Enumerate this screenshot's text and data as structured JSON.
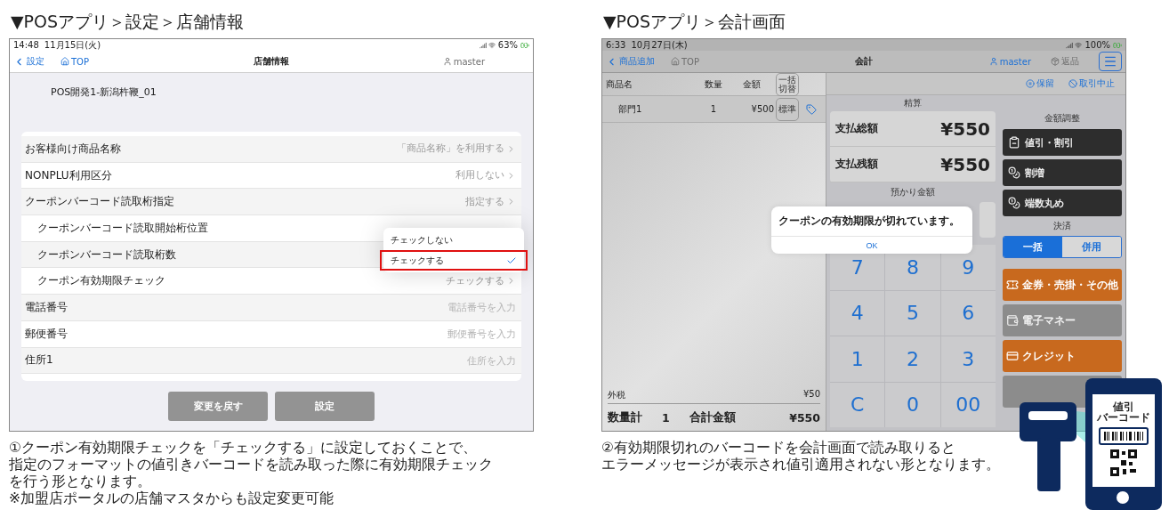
{
  "left_panel": {
    "heading": "▼POSアプリ＞設定＞店舗情報",
    "status_bar": {
      "time": "14:48",
      "date": "11月15日(火)",
      "battery": "63%"
    },
    "nav": {
      "back": "設定",
      "home": "TOP",
      "home_disabled": false,
      "title": "店舗情報",
      "user": "master",
      "user_disabled": true
    },
    "store_name": "POS開発1-新潟杵鞭_01",
    "rows": [
      {
        "kind": "select",
        "label": "お客様向け商品名称",
        "value": "「商品名称」を利用する",
        "indented": false
      },
      {
        "kind": "select",
        "label": "NONPLU利用区分",
        "value": "利用しない",
        "indented": false
      },
      {
        "kind": "select",
        "label": "クーポンバーコード読取桁指定",
        "value": "指定する",
        "indented": false
      },
      {
        "kind": "select",
        "label": "クーポンバーコード読取開始桁位置",
        "indented": true
      },
      {
        "kind": "select",
        "label": "クーポンバーコード読取桁数",
        "indented": true
      },
      {
        "kind": "select",
        "label": "クーポン有効期限チェック",
        "value": "チェックする",
        "indented": true
      },
      {
        "kind": "input",
        "label": "電話番号",
        "placeholder": "電話番号を入力",
        "indented": false
      },
      {
        "kind": "input",
        "label": "郵便番号",
        "placeholder": "郵便番号を入力",
        "indented": false
      },
      {
        "kind": "input",
        "label": "住所1",
        "placeholder": "住所を入力",
        "indented": false
      }
    ],
    "popup": {
      "options": [
        {
          "label": "チェックしない",
          "selected": false
        },
        {
          "label": "チェックする",
          "selected": true
        }
      ]
    },
    "buttons": [
      {
        "label": "変更を戻す",
        "disabled": true
      },
      {
        "label": "設定",
        "disabled": true
      }
    ],
    "caption": [
      "①クーポン有効期限チェックを「チェックする」に設定しておくことで、",
      "指定のフォーマットの値引きバーコードを読み取った際に有効期限チェック",
      "を行う形となります。",
      "※加盟店ポータルの店舗マスタからも設定変更可能"
    ]
  },
  "right_panel": {
    "heading": "▼POSアプリ＞会計画面",
    "status_bar": {
      "time": "6:33",
      "date": "10月27日(木)",
      "battery": "100%"
    },
    "nav": {
      "back": "商品追加",
      "home": "TOP",
      "home_disabled": true,
      "title": "会計",
      "user": "master",
      "user_disabled": false,
      "return": {
        "label": "返品",
        "disabled": true
      }
    },
    "cart": {
      "columns": [
        "商品名",
        "数量",
        "金額"
      ],
      "toggle_button": "一括切替",
      "rows": [
        {
          "name": "部門1",
          "qty": "1",
          "amount": "¥500",
          "tax": "標準"
        }
      ],
      "tax_label": "外税",
      "tax_amount": "¥50",
      "qty_total_label": "数量計",
      "qty_total": "1",
      "total_label": "合計金額",
      "total": "¥550"
    },
    "actions": [
      "保留",
      "取引中止"
    ],
    "settlement": {
      "label": "精算",
      "rows": [
        {
          "label": "支払総額",
          "amount": "¥550"
        },
        {
          "label": "支払残額",
          "amount": "¥550"
        }
      ]
    },
    "deposit_label": "預かり金額",
    "keypad": [
      "7",
      "8",
      "9",
      "4",
      "5",
      "6",
      "1",
      "2",
      "3",
      "C",
      "0",
      "00"
    ],
    "adjust": {
      "label": "金額調整",
      "buttons": [
        "値引・割引",
        "割増",
        "端数丸め"
      ]
    },
    "payment": {
      "label": "決済",
      "modes": [
        {
          "label": "一括",
          "selected": true
        },
        {
          "label": "併用",
          "selected": false
        }
      ],
      "methods": [
        {
          "label": "金券・売掛・その他",
          "disabled": false
        },
        {
          "label": "電子マネー",
          "disabled": true
        },
        {
          "label": "クレジット",
          "disabled": false
        }
      ]
    },
    "dialog": {
      "message": "クーポンの有効期限が切れています。",
      "button": "OK"
    },
    "caption": [
      "②有効期限切れのバーコードを会計画面で読み取りると",
      "エラーメッセージが表示され値引適用されない形となります。"
    ]
  },
  "illustration": {
    "phone_label": [
      "値引",
      "バーコード"
    ]
  }
}
